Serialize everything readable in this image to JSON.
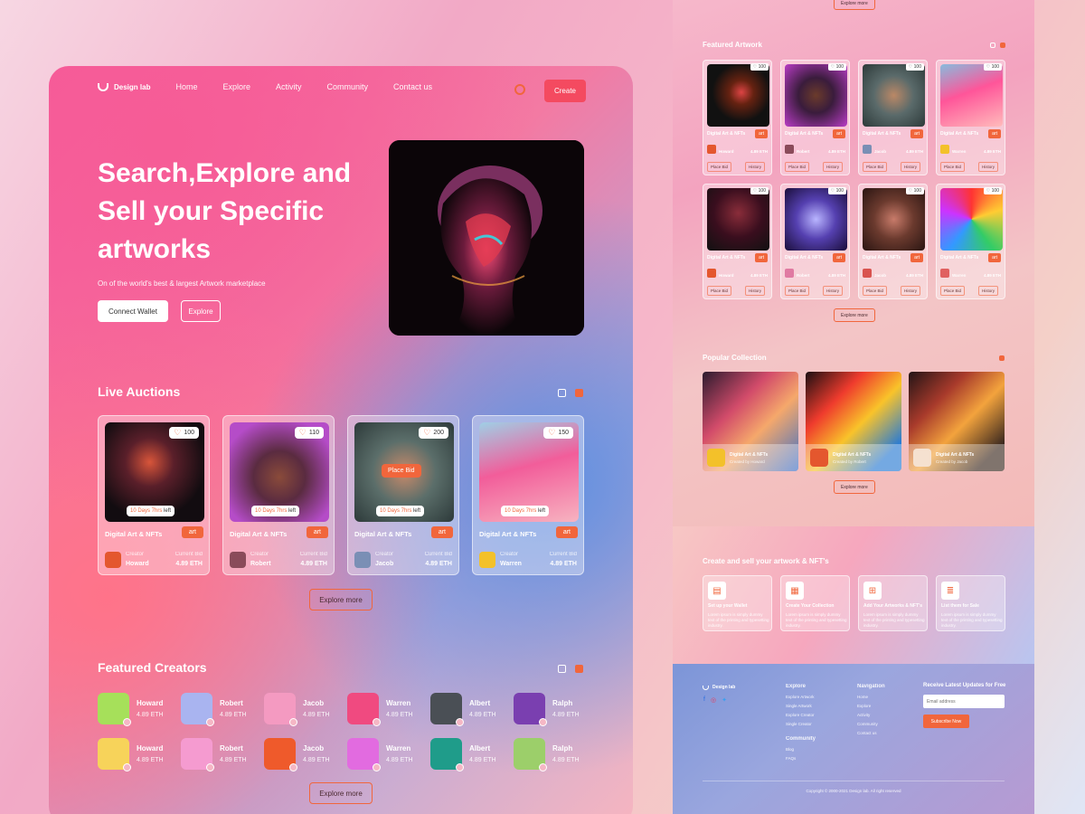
{
  "brand": {
    "name": "Design lab"
  },
  "nav": {
    "items": [
      "Home",
      "Explore",
      "Activity",
      "Community",
      "Contact us"
    ],
    "create": "Create"
  },
  "hero": {
    "title": "Search,Explore and Sell your Specific artworks",
    "subtitle": "On of the world's best & largest Artwork marketplace",
    "connect": "Connect Wallet",
    "explore": "Explore"
  },
  "live": {
    "title": "Live Auctions",
    "explore": "Explore more",
    "place_bid": "Place Bid",
    "cards": [
      {
        "likes": "100",
        "time": "10 Days 7hrs",
        "time_suffix": "left",
        "title": "Digital Art & NFTs",
        "tag": "art",
        "creator_label": "Creator",
        "creator": "Howard",
        "bid_label": "Current Bid",
        "bid": "4.89 ETH"
      },
      {
        "likes": "110",
        "time": "10 Days 7hrs",
        "time_suffix": "left",
        "title": "Digital Art & NFTs",
        "tag": "art",
        "creator_label": "Creator",
        "creator": "Robert",
        "bid_label": "Current Bid",
        "bid": "4.89 ETH"
      },
      {
        "likes": "200",
        "time": "10 Days 7hrs",
        "time_suffix": "left",
        "title": "Digital Art & NFTs",
        "tag": "art",
        "creator_label": "Creator",
        "creator": "Jacob",
        "bid_label": "Current Bid",
        "bid": "4.89 ETH"
      },
      {
        "likes": "150",
        "time": "10 Days 7hrs",
        "time_suffix": "left",
        "title": "Digital Art & NFTs",
        "tag": "art",
        "creator_label": "Creator",
        "creator": "Warren",
        "bid_label": "Current Bid",
        "bid": "4.89 ETH"
      }
    ]
  },
  "creators": {
    "title": "Featured Creators",
    "explore": "Explore more",
    "items": [
      {
        "name": "Howard",
        "eth": "4.89 ETH"
      },
      {
        "name": "Robert",
        "eth": "4.89 ETH"
      },
      {
        "name": "Jacob",
        "eth": "4.89 ETH"
      },
      {
        "name": "Warren",
        "eth": "4.89 ETH"
      },
      {
        "name": "Albert",
        "eth": "4.89 ETH"
      },
      {
        "name": "Ralph",
        "eth": "4.89 ETH"
      },
      {
        "name": "Howard",
        "eth": "4.89 ETH"
      },
      {
        "name": "Robert",
        "eth": "4.89 ETH"
      },
      {
        "name": "Jacob",
        "eth": "4.89 ETH"
      },
      {
        "name": "Warren",
        "eth": "4.89 ETH"
      },
      {
        "name": "Albert",
        "eth": "4.89 ETH"
      },
      {
        "name": "Ralph",
        "eth": "4.89 ETH"
      }
    ]
  },
  "featured": {
    "title": "Featured Artwork",
    "explore_top": "Explore more",
    "explore": "Explore more",
    "cards": [
      {
        "likes": "100",
        "title": "Digital Art & NFTs",
        "tag": "art",
        "creator": "Howard",
        "bid": "4.89 ETH",
        "bid_btn": "Place Bid",
        "history": "History"
      },
      {
        "likes": "100",
        "title": "Digital Art & NFTs",
        "tag": "art",
        "creator": "Robert",
        "bid": "4.89 ETH",
        "bid_btn": "Place Bid",
        "history": "History"
      },
      {
        "likes": "100",
        "title": "Digital Art & NFTs",
        "tag": "art",
        "creator": "Jacob",
        "bid": "4.89 ETH",
        "bid_btn": "Place Bid",
        "history": "History"
      },
      {
        "likes": "100",
        "title": "Digital Art & NFTs",
        "tag": "art",
        "creator": "Warren",
        "bid": "4.89 ETH",
        "bid_btn": "Place Bid",
        "history": "History"
      },
      {
        "likes": "100",
        "title": "Digital Art & NFTs",
        "tag": "art",
        "creator": "Howard",
        "bid": "4.89 ETH",
        "bid_btn": "Place Bid",
        "history": "History"
      },
      {
        "likes": "100",
        "title": "Digital Art & NFTs",
        "tag": "art",
        "creator": "Robert",
        "bid": "4.89 ETH",
        "bid_btn": "Place Bid",
        "history": "History"
      },
      {
        "likes": "100",
        "title": "Digital Art & NFTs",
        "tag": "art",
        "creator": "Jacob",
        "bid": "4.89 ETH",
        "bid_btn": "Place Bid",
        "history": "History"
      },
      {
        "likes": "100",
        "title": "Digital Art & NFTs",
        "tag": "art",
        "creator": "Warren",
        "bid": "4.89 ETH",
        "bid_btn": "Place Bid",
        "history": "History"
      }
    ]
  },
  "popular": {
    "title": "Popular Collection",
    "explore": "Explore more",
    "items": [
      {
        "title": "Digital Art & NFTs",
        "sub": "Created by Howard"
      },
      {
        "title": "Digital Art & NFTs",
        "sub": "Created by Robert"
      },
      {
        "title": "Digital Art & NFTs",
        "sub": "Created by Jacob"
      }
    ]
  },
  "create_sell": {
    "title": "Create and sell your artwork & NFT's",
    "steps": [
      {
        "title": "Set up your Wallet",
        "desc": "Lorem ipsum is simply dummy text of the printing and typesetting industry."
      },
      {
        "title": "Create Your Collection",
        "desc": "Lorem ipsum is simply dummy text of the printing and typesetting industry."
      },
      {
        "title": "Add Your Artworks & NFT's",
        "desc": "Lorem ipsum is simply dummy text of the printing and typesetting industry."
      },
      {
        "title": "List them for Sale",
        "desc": "Lorem ipsum is simply dummy text of the printing and typesetting industry."
      }
    ]
  },
  "footer": {
    "brand": "Design lab",
    "explore_title": "Explore",
    "explore_links": [
      "Explore Artwork",
      "Single Artwork",
      "Explore Creator",
      "Single Creator"
    ],
    "community_title": "Community",
    "community_links": [
      "Blog",
      "FAQs"
    ],
    "nav_title": "Navigation",
    "nav_links": [
      "Home",
      "Explore",
      "Activity",
      "Community",
      "Contact us"
    ],
    "newsletter_title": "Receive Latest Updates for Free",
    "email_placeholder": "Email address",
    "subscribe": "Subscribe Now",
    "copyright": "Copyright © 2000-2021 Design lab. All right reserved"
  },
  "colors": {
    "accent": "#f1663c",
    "create": "#f44a60",
    "panel_pink": "#f6589d",
    "panel_blue": "#5f8fe0"
  }
}
